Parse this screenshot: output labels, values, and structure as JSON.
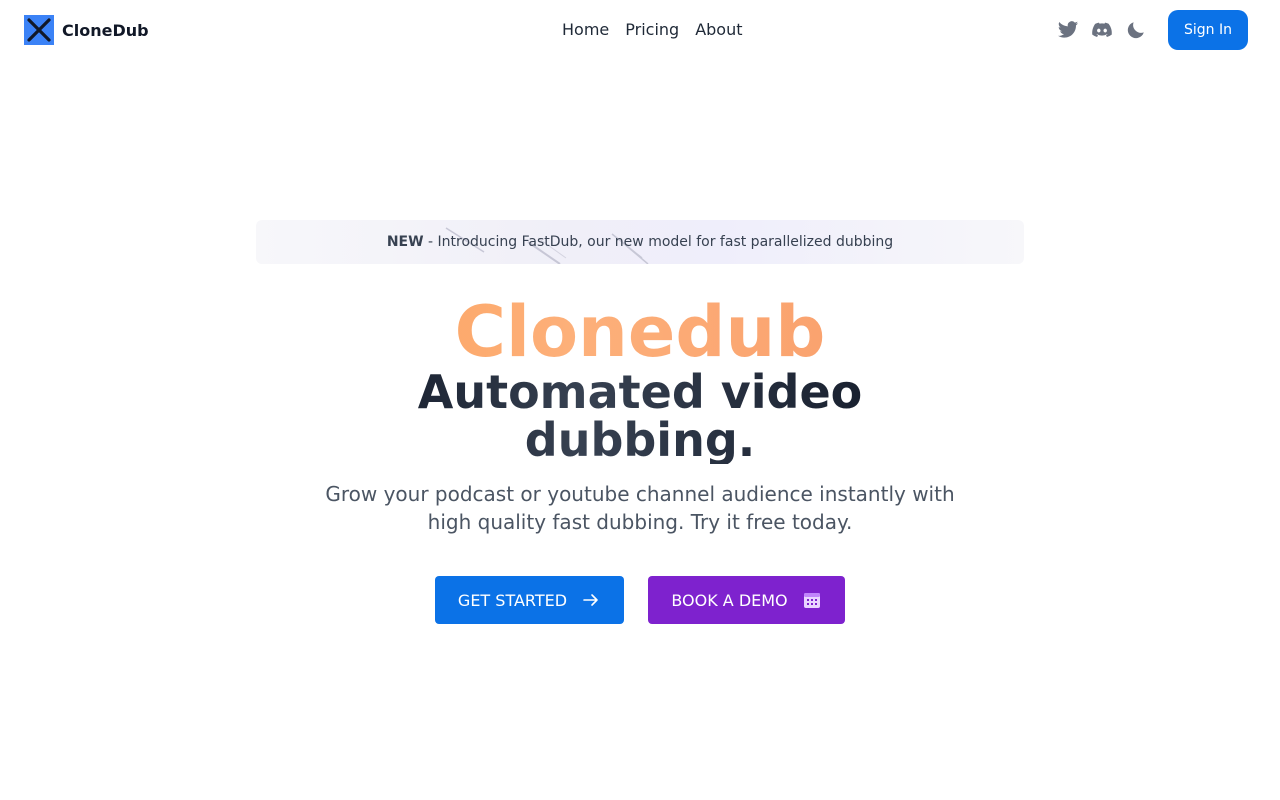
{
  "header": {
    "brand_name": "CloneDub",
    "nav": [
      {
        "label": "Home"
      },
      {
        "label": "Pricing"
      },
      {
        "label": "About"
      }
    ],
    "icons": [
      "twitter-icon",
      "discord-icon",
      "moon-icon"
    ],
    "signin_label": "Sign In"
  },
  "banner": {
    "tag": "NEW",
    "text": " - Introducing FastDub, our new model for fast parallelized dubbing"
  },
  "hero": {
    "brand": "Clonedub",
    "title": "Automated video dubbing.",
    "subtitle": "Grow your podcast or youtube channel audience instantly with high quality fast dubbing. Try it free today.",
    "primary_cta": "GET STARTED",
    "secondary_cta": "BOOK A DEMO"
  },
  "colors": {
    "accent_blue": "#0b72e7",
    "accent_purple": "#7e22ce",
    "brand_orange": "#fb923c"
  }
}
